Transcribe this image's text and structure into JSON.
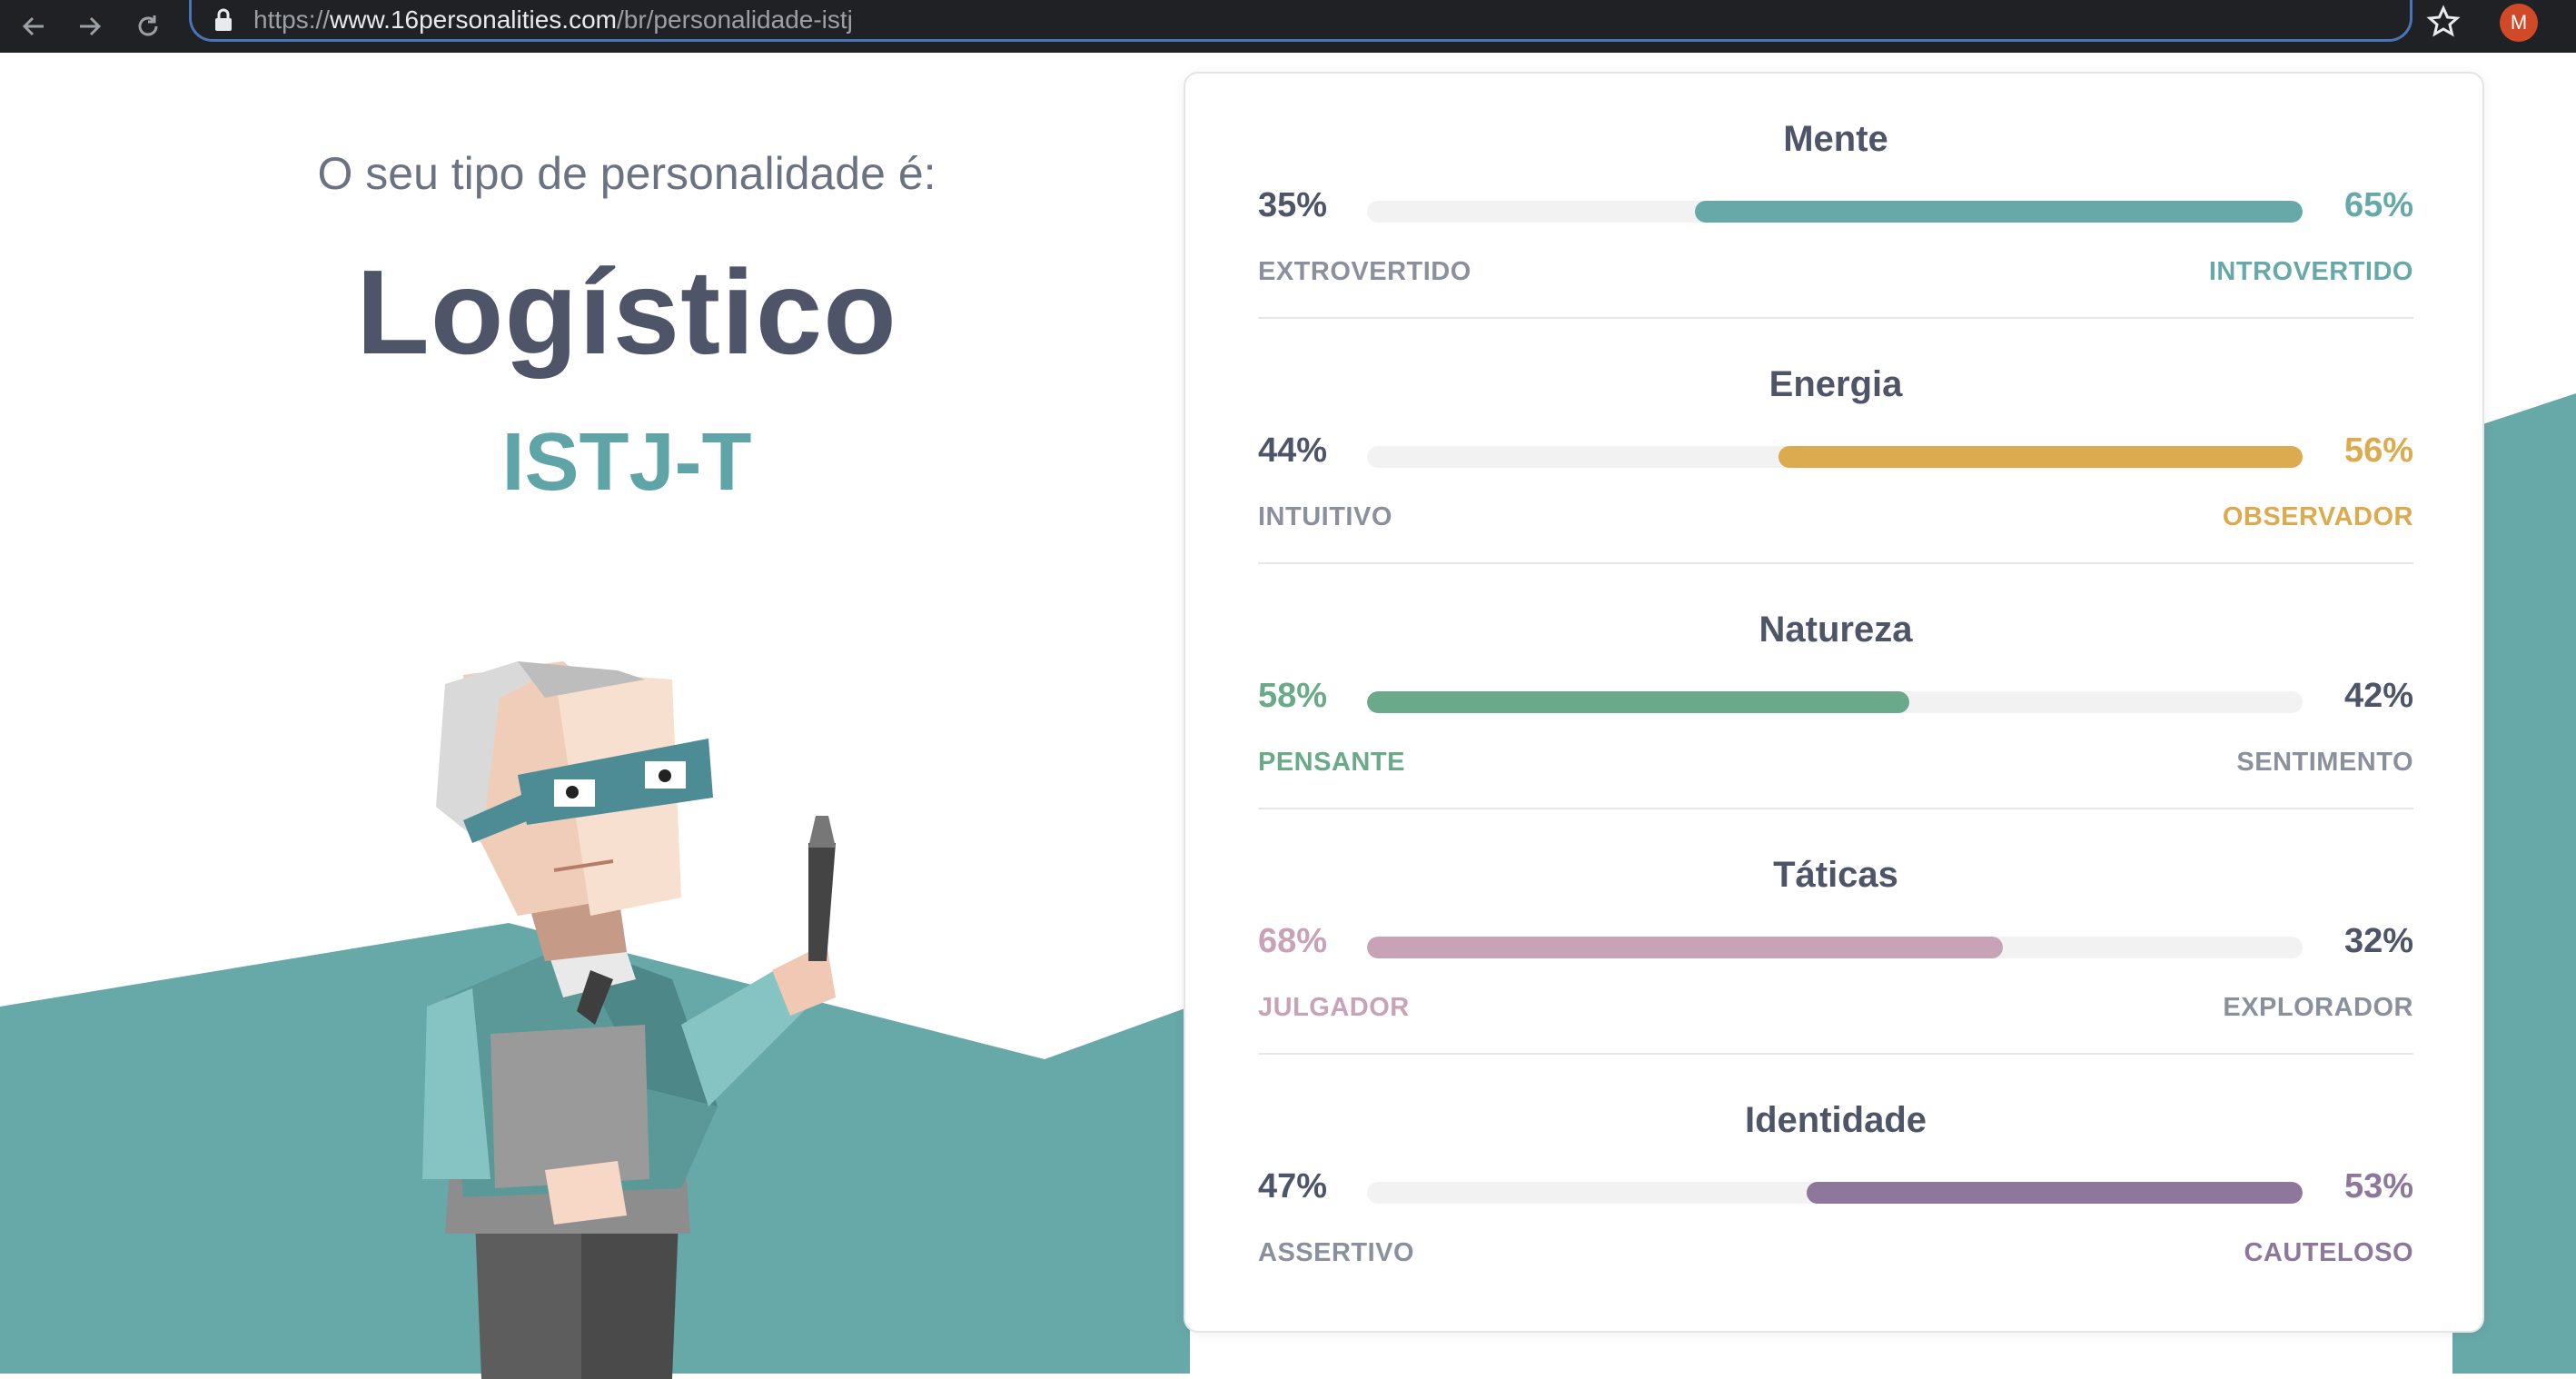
{
  "browser": {
    "url_prefix": "https://",
    "url_host": "www.16personalities.com",
    "url_path": "/br/personalidade-istj",
    "profile_initial": "M",
    "icons": [
      "back-arrow-icon",
      "forward-arrow-icon",
      "reload-icon",
      "lock-icon",
      "star-icon"
    ]
  },
  "result": {
    "intro": "O seu tipo de personalidade é:",
    "type_name": "Logístico",
    "type_code": "ISTJ-T"
  },
  "colors": {
    "teal": "#67a9a9",
    "yellow": "#dcaa4f",
    "green": "#6aa989",
    "pink": "#c8a2b6",
    "purple": "#8d789c",
    "neutral_text": "#4e5568"
  },
  "traits": [
    {
      "title": "Mente",
      "left_pct": "35%",
      "right_pct": "65%",
      "left_label": "EXTROVERTIDO",
      "right_label": "INTROVERTIDO",
      "dominant": "right",
      "value": 0.65,
      "color": "#67a9a9"
    },
    {
      "title": "Energia",
      "left_pct": "44%",
      "right_pct": "56%",
      "left_label": "INTUITIVO",
      "right_label": "OBSERVADOR",
      "dominant": "right",
      "value": 0.56,
      "color": "#dcaa4f"
    },
    {
      "title": "Natureza",
      "left_pct": "58%",
      "right_pct": "42%",
      "left_label": "PENSANTE",
      "right_label": "SENTIMENTO",
      "dominant": "left",
      "value": 0.58,
      "color": "#6aa989"
    },
    {
      "title": "Táticas",
      "left_pct": "68%",
      "right_pct": "32%",
      "left_label": "JULGADOR",
      "right_label": "EXPLORADOR",
      "dominant": "left",
      "value": 0.68,
      "color": "#c8a2b6"
    },
    {
      "title": "Identidade",
      "left_pct": "47%",
      "right_pct": "53%",
      "left_label": "ASSERTIVO",
      "right_label": "CAUTELOSO",
      "dominant": "right",
      "value": 0.53,
      "color": "#8d789c"
    }
  ]
}
